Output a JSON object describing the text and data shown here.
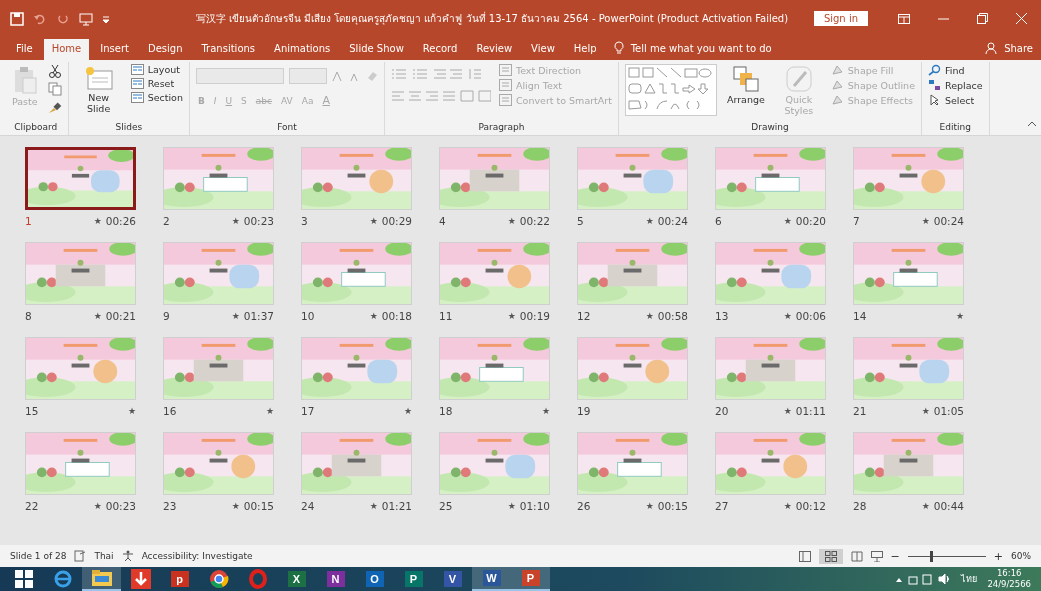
{
  "window": {
    "title": "写汉字 เขียนตัวอักษรจีน มีเสียง โดยคุณครูสุภัคชญา แก้วคำฟู วันที่ 13-17 ธันวาคม 2564  -  PowerPoint (Product Activation Failed)",
    "sign_in": "Sign in"
  },
  "tabs": [
    {
      "label": "File",
      "selected": false
    },
    {
      "label": "Home",
      "selected": true
    },
    {
      "label": "Insert",
      "selected": false
    },
    {
      "label": "Design",
      "selected": false
    },
    {
      "label": "Transitions",
      "selected": false
    },
    {
      "label": "Animations",
      "selected": false
    },
    {
      "label": "Slide Show",
      "selected": false
    },
    {
      "label": "Record",
      "selected": false
    },
    {
      "label": "Review",
      "selected": false
    },
    {
      "label": "View",
      "selected": false
    },
    {
      "label": "Help",
      "selected": false
    }
  ],
  "tell_me": "Tell me what you want to do",
  "share": "Share",
  "ribbon": [
    {
      "kind": "clipboard",
      "label": "Clipboard",
      "items": [
        {
          "label": "Paste",
          "disabled": true
        }
      ]
    },
    {
      "kind": "slides",
      "label": "Slides",
      "items": [
        {
          "label": "New Slide",
          "disabled": false
        },
        {
          "label": "Layout",
          "disabled": false
        },
        {
          "label": "Reset",
          "disabled": false
        },
        {
          "label": "Section",
          "disabled": false
        }
      ]
    },
    {
      "kind": "font",
      "label": "Font",
      "items": [
        {
          "label": "B",
          "disabled": true
        },
        {
          "label": "I",
          "disabled": true
        },
        {
          "label": "U",
          "disabled": true
        },
        {
          "label": "S",
          "disabled": true
        },
        {
          "label": "abc",
          "disabled": true
        },
        {
          "label": "AV",
          "disabled": true
        },
        {
          "label": "Aa",
          "disabled": true
        },
        {
          "label": "A",
          "disabled": true
        }
      ]
    },
    {
      "kind": "paragraph",
      "label": "Paragraph",
      "items": [
        {
          "label": "Text Direction",
          "disabled": true
        },
        {
          "label": "Align Text",
          "disabled": true
        },
        {
          "label": "Convert to SmartArt",
          "disabled": true
        }
      ]
    },
    {
      "kind": "drawing",
      "label": "Drawing",
      "items": [
        {
          "label": "Arrange",
          "disabled": false
        },
        {
          "label": "Quick Styles",
          "disabled": true
        },
        {
          "label": "Shape Fill",
          "disabled": true
        },
        {
          "label": "Shape Outline",
          "disabled": true
        },
        {
          "label": "Shape Effects",
          "disabled": true
        }
      ]
    },
    {
      "kind": "editing",
      "label": "Editing",
      "items": [
        {
          "label": "Find",
          "disabled": false
        },
        {
          "label": "Replace",
          "disabled": false
        },
        {
          "label": "Select",
          "disabled": false
        }
      ]
    }
  ],
  "slides": [
    {
      "number": "1",
      "star": "★",
      "time": "00:26",
      "selected": true
    },
    {
      "number": "2",
      "star": "★",
      "time": "00:23",
      "selected": false
    },
    {
      "number": "3",
      "star": "★",
      "time": "00:29",
      "selected": false
    },
    {
      "number": "4",
      "star": "★",
      "time": "00:22",
      "selected": false
    },
    {
      "number": "5",
      "star": "★",
      "time": "00:24",
      "selected": false
    },
    {
      "number": "6",
      "star": "★",
      "time": "00:20",
      "selected": false
    },
    {
      "number": "7",
      "star": "★",
      "time": "00:24",
      "selected": false
    },
    {
      "number": "8",
      "star": "★",
      "time": "00:21",
      "selected": false
    },
    {
      "number": "9",
      "star": "★",
      "time": "01:37",
      "selected": false
    },
    {
      "number": "10",
      "star": "★",
      "time": "00:18",
      "selected": false
    },
    {
      "number": "11",
      "star": "★",
      "time": "00:19",
      "selected": false
    },
    {
      "number": "12",
      "star": "★",
      "time": "00:58",
      "selected": false
    },
    {
      "number": "13",
      "star": "★",
      "time": "00:06",
      "selected": false
    },
    {
      "number": "14",
      "star": "★",
      "selected": false
    },
    {
      "number": "15",
      "star": "★",
      "selected": false
    },
    {
      "number": "16",
      "star": "★",
      "selected": false
    },
    {
      "number": "17",
      "star": "★",
      "selected": false
    },
    {
      "number": "18",
      "star": "★",
      "selected": false
    },
    {
      "number": "19",
      "selected": false
    },
    {
      "number": "20",
      "star": "★",
      "time": "01:11",
      "selected": false
    },
    {
      "number": "21",
      "star": "★",
      "time": "01:05",
      "selected": false
    },
    {
      "number": "22",
      "star": "★",
      "time": "00:23",
      "selected": false
    },
    {
      "number": "23",
      "star": "★",
      "time": "00:15",
      "selected": false
    },
    {
      "number": "24",
      "star": "★",
      "time": "01:21",
      "selected": false
    },
    {
      "number": "25",
      "star": "★",
      "time": "01:10",
      "selected": false
    },
    {
      "number": "26",
      "star": "★",
      "time": "00:15",
      "selected": false
    },
    {
      "number": "27",
      "star": "★",
      "time": "00:12",
      "selected": false
    },
    {
      "number": "28",
      "star": "★",
      "time": "00:44",
      "selected": false
    }
  ],
  "status_bar": {
    "slide": "Slide 1 of 28",
    "language": "Thai",
    "accessibility": "Accessibility: Investigate",
    "zoom": {
      "level": 0.28
    },
    "zoom_out": "−",
    "zoom_in": "+",
    "zoom_text": "60%"
  },
  "taskbar": {
    "apps": [
      {
        "kind": "start"
      },
      {
        "kind": "ie"
      },
      {
        "kind": "folder",
        "active": true
      },
      {
        "kind": "download"
      },
      {
        "kind": "letter",
        "letter": "p",
        "color": "#c8321e",
        "active": false
      },
      {
        "kind": "chrome"
      },
      {
        "kind": "opera"
      },
      {
        "kind": "letter",
        "letter": "X",
        "color": "#1d7044",
        "active": false
      },
      {
        "kind": "letter",
        "letter": "N",
        "color": "#7d2f9d",
        "active": false
      },
      {
        "kind": "letter",
        "letter": "O",
        "color": "#0f64b4",
        "active": false
      },
      {
        "kind": "letter",
        "letter": "P",
        "color": "#077568",
        "active": false
      },
      {
        "kind": "letter",
        "letter": "V",
        "color": "#3455a6",
        "active": false
      },
      {
        "kind": "letter",
        "letter": "W",
        "color": "#2b579a",
        "active": true
      },
      {
        "kind": "letter",
        "letter": "P",
        "color": "#c9432a",
        "active": true
      }
    ],
    "language": "ไทย",
    "time": "16:16",
    "date": "24/9/2566"
  }
}
